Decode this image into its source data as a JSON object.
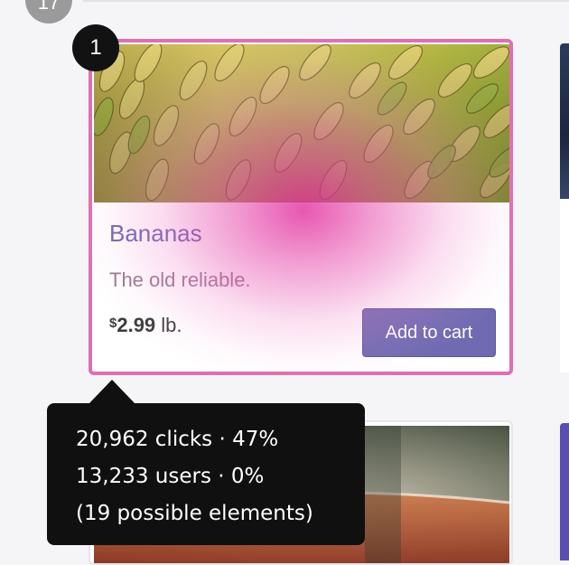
{
  "heatmap": {
    "top_marker": "17",
    "marker_number": "1",
    "color": "#e0359f",
    "tooltip": {
      "clicks_line": "20,962 clicks · 47%",
      "users_line": "13,233 users · 0%",
      "elements_line": "(19 possible elements)"
    }
  },
  "product_card": {
    "title": "Bananas",
    "description": "The old reliable.",
    "price_currency": "$",
    "price_amount": "2.99",
    "price_unit": " lb.",
    "add_to_cart_label": "Add to cart",
    "border_color": "#de6fb3",
    "button_color": "#6f6ab1"
  }
}
